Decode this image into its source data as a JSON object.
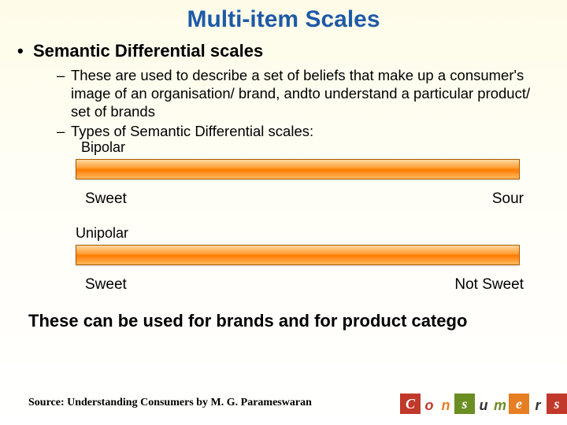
{
  "title": "Multi-item Scales",
  "main_bullet": "Semantic Differential scales",
  "sub_items": [
    "These are used to describe a set of beliefs that make up a consumer's image of an organisation/ brand, andto understand a particular product/ set of brands",
    "Types of Semantic Differential scales:"
  ],
  "scale1": {
    "type": "Bipolar",
    "left": "Sweet",
    "right": "Sour"
  },
  "scale2": {
    "type": "Unipolar",
    "left": "Sweet",
    "right": "Not Sweet"
  },
  "closing": "These can be used for brands and for product catego",
  "source": "Source: Understanding Consumers by M. G. Parameswaran",
  "logo_letters": {
    "c": "C",
    "o": "o",
    "n": "n",
    "s": "s",
    "u": "u",
    "m": "m",
    "e": "e",
    "r": "r",
    "s2": "s"
  }
}
